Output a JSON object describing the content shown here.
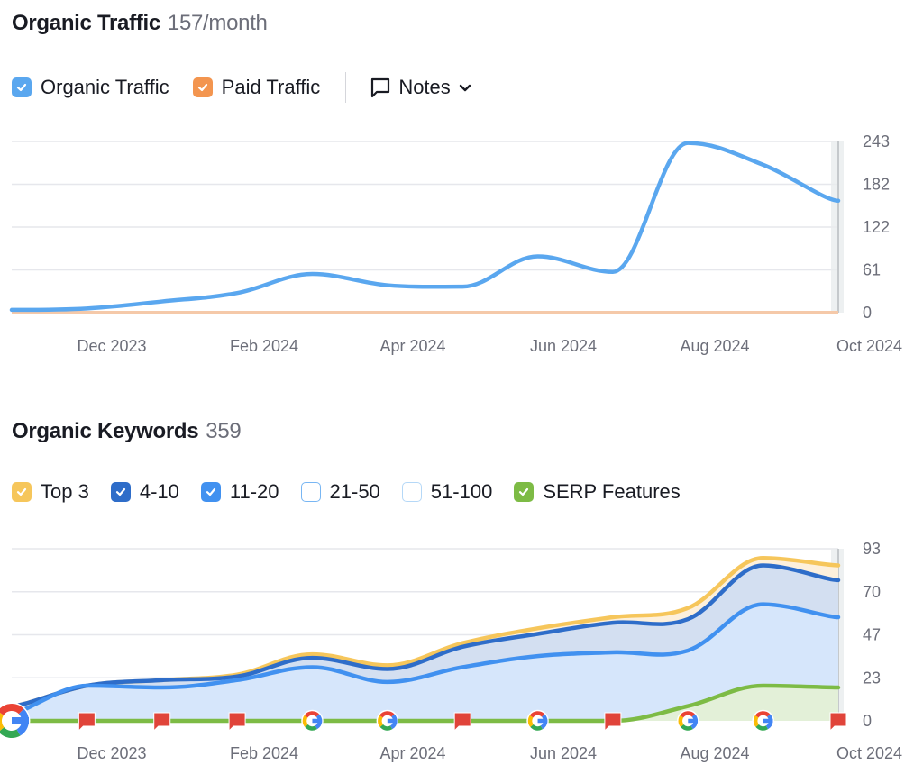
{
  "traffic": {
    "title": "Organic Traffic",
    "count": "157/month",
    "legend": [
      {
        "label": "Organic Traffic",
        "color": "#5aa7ef",
        "checked": true,
        "icon": "checkbox-checked-icon"
      },
      {
        "label": "Paid Traffic",
        "color": "#f3954f",
        "checked": true,
        "icon": "checkbox-checked-icon"
      }
    ],
    "notes": {
      "label": "Notes",
      "icon": "comment-icon",
      "dropdown_icon": "chevron-down-icon"
    }
  },
  "keywords": {
    "title": "Organic Keywords",
    "count": "359",
    "legend": [
      {
        "label": "Top 3",
        "color": "#f6c65b",
        "checked": true
      },
      {
        "label": "4-10",
        "color": "#2e6dc9",
        "checked": true
      },
      {
        "label": "11-20",
        "color": "#4191f0",
        "checked": true
      },
      {
        "label": "21-50",
        "color": "#78b6f3",
        "checked": false
      },
      {
        "label": "51-100",
        "color": "#b5d8f7",
        "checked": false
      },
      {
        "label": "SERP Features",
        "color": "#7dbb45",
        "checked": true
      }
    ]
  },
  "chart_data": [
    {
      "type": "line",
      "title": "Organic Traffic",
      "xlabel": "",
      "ylabel": "",
      "x_tick_labels": [
        "Dec 2023",
        "Feb 2024",
        "Apr 2024",
        "Jun 2024",
        "Aug 2024",
        "Oct 2024"
      ],
      "y_tick_labels": [
        "0",
        "61",
        "122",
        "182",
        "243"
      ],
      "ylim": [
        0,
        243
      ],
      "grid": true,
      "x": [
        "Oct 2023",
        "Nov 2023",
        "Dec 2023",
        "Jan 2024",
        "Feb 2024",
        "Mar 2024",
        "Apr 2024",
        "May 2024",
        "Jun 2024",
        "Jul 2024",
        "Aug 2024",
        "Sep 2024"
      ],
      "series": [
        {
          "name": "Organic Traffic",
          "color": "#5aa7ef",
          "values": [
            2,
            4,
            14,
            26,
            53,
            37,
            35,
            78,
            56,
            239,
            208,
            157
          ]
        },
        {
          "name": "Paid Traffic",
          "color": "#f3954f",
          "values": [
            0,
            0,
            0,
            0,
            0,
            0,
            0,
            0,
            0,
            0,
            0,
            0
          ]
        }
      ]
    },
    {
      "type": "area",
      "title": "Organic Keywords",
      "xlabel": "",
      "ylabel": "",
      "x_tick_labels": [
        "Dec 2023",
        "Feb 2024",
        "Apr 2024",
        "Jun 2024",
        "Aug 2024",
        "Oct 2024"
      ],
      "y_tick_labels": [
        "0",
        "23",
        "47",
        "70",
        "93"
      ],
      "ylim": [
        0,
        93
      ],
      "grid": true,
      "x": [
        "Oct 2023",
        "Nov 2023",
        "Dec 2023",
        "Jan 2024",
        "Feb 2024",
        "Mar 2024",
        "Apr 2024",
        "May 2024",
        "Jun 2024",
        "Jul 2024",
        "Aug 2024",
        "Sep 2024"
      ],
      "series": [
        {
          "name": "Top 3",
          "color": "#f6c65b",
          "fill": "#fdf0dc",
          "values": [
            8,
            19,
            22,
            25,
            36,
            30,
            42,
            50,
            56,
            61,
            88,
            84
          ]
        },
        {
          "name": "4-10",
          "color": "#2e6dc9",
          "fill": "#d3dff1",
          "values": [
            8,
            19,
            22,
            24,
            34,
            28,
            40,
            47,
            53,
            55,
            84,
            76
          ]
        },
        {
          "name": "11-20",
          "color": "#4191f0",
          "fill": "#d6e6fb",
          "values": [
            4,
            19,
            18,
            22,
            29,
            21,
            29,
            35,
            37,
            38,
            63,
            56
          ]
        },
        {
          "name": "SERP Features",
          "color": "#7dbb45",
          "fill": "#e3f0d8",
          "values": [
            0,
            0,
            0,
            0,
            0,
            0,
            0,
            0,
            0,
            8,
            19,
            18
          ]
        }
      ],
      "markers": [
        "google-update",
        "note",
        "note",
        "note",
        "google-update",
        "google-update",
        "note",
        "google-update",
        "note",
        "google-update",
        "google-update",
        "note"
      ]
    }
  ]
}
